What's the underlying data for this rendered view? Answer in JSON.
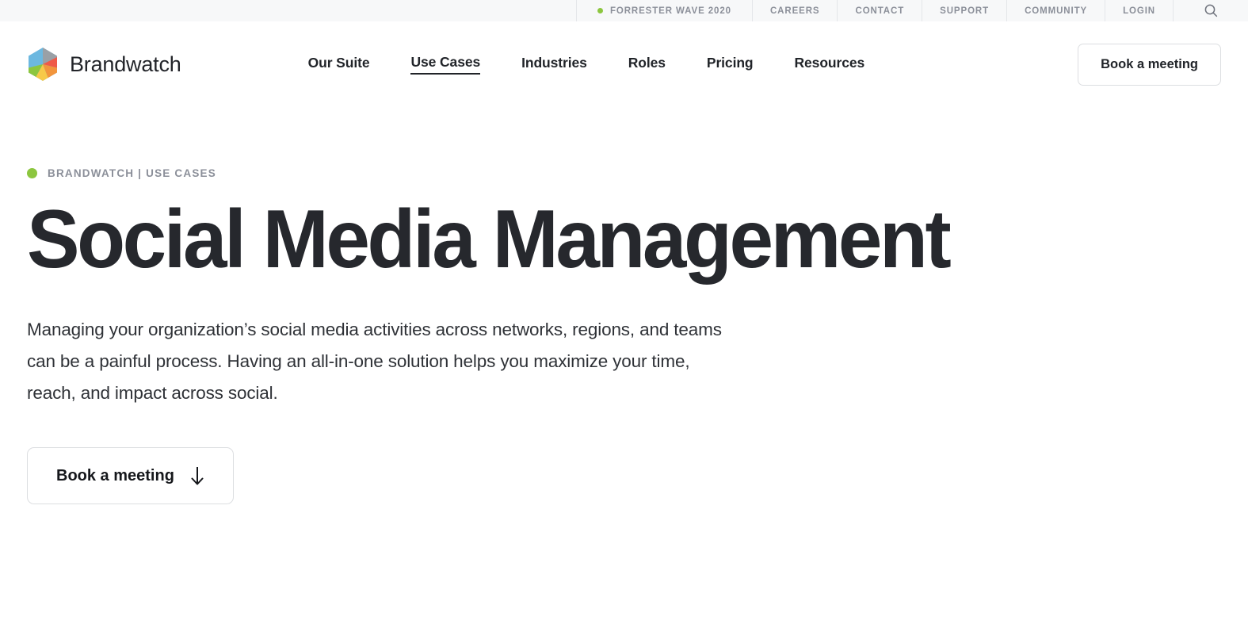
{
  "utility_bar": {
    "items": [
      {
        "label": "FORRESTER WAVE 2020",
        "dot": true,
        "dot_color": "#8cc63f"
      },
      {
        "label": "CAREERS",
        "dot": false
      },
      {
        "label": "CONTACT",
        "dot": false
      },
      {
        "label": "SUPPORT",
        "dot": false
      },
      {
        "label": "COMMUNITY",
        "dot": false
      },
      {
        "label": "LOGIN",
        "dot": false
      }
    ],
    "search_icon": "search-icon",
    "text_color": "#8b8f99",
    "background": "#f7f8f9"
  },
  "header": {
    "brand_name": "Brandwatch",
    "logo_icon": "brandwatch-hexagon-logo",
    "logo_colors": {
      "blue": "#6cb8e0",
      "gray": "#9aa0a6",
      "red": "#ef5a48",
      "orange": "#f2953c",
      "yellow": "#f7c948",
      "green": "#8cc63f"
    },
    "nav": [
      {
        "label": "Our Suite",
        "active": false
      },
      {
        "label": "Use Cases",
        "active": true
      },
      {
        "label": "Industries",
        "active": false
      },
      {
        "label": "Roles",
        "active": false
      },
      {
        "label": "Pricing",
        "active": false
      },
      {
        "label": "Resources",
        "active": false
      }
    ],
    "cta_label": "Book a meeting"
  },
  "hero": {
    "eyebrow": "BRANDWATCH | USE CASES",
    "eyebrow_dot_color": "#8cc63f",
    "title": "Social Media Management",
    "description": "Managing your organization’s social media activities across networks, regions, and teams can be a painful process. Having an all-in-one solution helps you maximize your time, reach, and impact across social.",
    "cta_label": "Book a meeting",
    "cta_icon": "arrow-down-icon"
  }
}
